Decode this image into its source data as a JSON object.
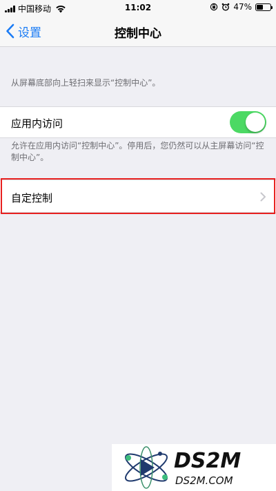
{
  "status_bar": {
    "carrier": "中国移动",
    "time": "11:02",
    "battery_percent": "47%",
    "battery_level": 0.47
  },
  "nav": {
    "back_label": "设置",
    "title": "控制中心"
  },
  "content": {
    "intro_text": "从屏幕底部向上轻扫来显示“控制中心”。",
    "access_in_apps": {
      "label": "应用内访问",
      "enabled": true
    },
    "access_footer": "允许在应用内访问“控制中心”。停用后，您仍然可以从主屏幕访问“控制中心”。",
    "customize_controls_label": "自定控制"
  },
  "watermark": {
    "logo_text": "DS2M",
    "site_text": "DS2M.COM"
  },
  "colors": {
    "accent": "#1b7cf5",
    "toggle_on": "#4cd964",
    "highlight": "#e8201f",
    "background": "#efeff4"
  }
}
